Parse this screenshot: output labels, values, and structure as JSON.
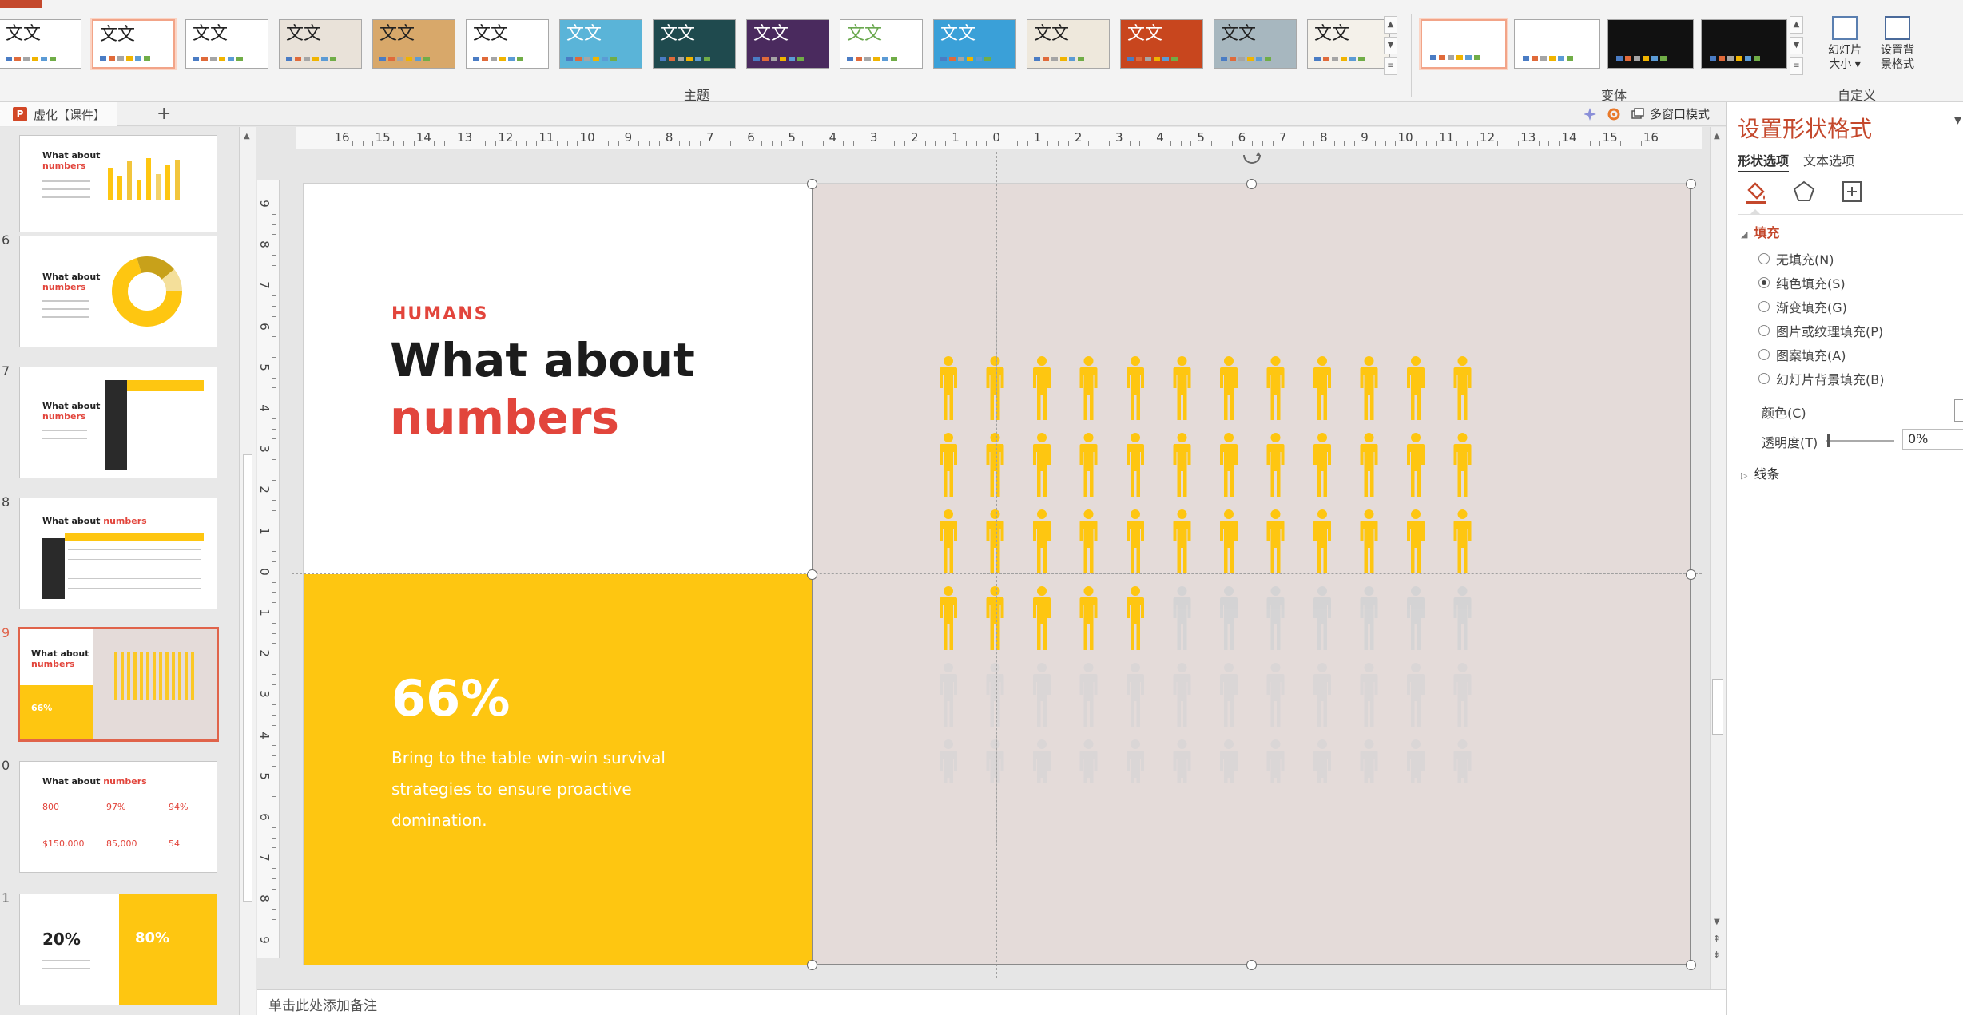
{
  "ribbon": {
    "theme_group_label": "主题",
    "variant_group_label": "变体",
    "custom_group_label": "自定义",
    "theme_sample_text": "文文",
    "slide_size_label_1": "幻灯片",
    "slide_size_label_2": "大小 ▾",
    "bg_format_label_1": "设置背",
    "bg_format_label_2": "景格式",
    "themes": [
      {
        "bg": "#ffffff",
        "fg": "#222222"
      },
      {
        "bg": "#ffffff",
        "fg": "#222222",
        "selected": true
      },
      {
        "bg": "#ffffff",
        "fg": "#222222"
      },
      {
        "bg": "#e9e2d9",
        "fg": "#222222"
      },
      {
        "bg": "#d8a86a",
        "fg": "#222222"
      },
      {
        "bg": "#ffffff",
        "fg": "#222222"
      },
      {
        "bg": "#5ab4d8",
        "fg": "#ffffff"
      },
      {
        "bg": "#1f4a4e",
        "fg": "#ffffff"
      },
      {
        "bg": "#4a2a5e",
        "fg": "#ffffff"
      },
      {
        "bg": "#ffffff",
        "fg": "#6aa84f"
      },
      {
        "bg": "#3aa0d8",
        "fg": "#ffffff"
      },
      {
        "bg": "#eee8dc",
        "fg": "#222222"
      },
      {
        "bg": "#c8461e",
        "fg": "#ffffff"
      },
      {
        "bg": "#a7b7bf",
        "fg": "#222222"
      },
      {
        "bg": "#f4f1ea",
        "fg": "#222222"
      }
    ],
    "variants": [
      {
        "bg": "#ffffff",
        "selected": true
      },
      {
        "bg": "#ffffff"
      },
      {
        "bg": "#111111"
      },
      {
        "bg": "#111111"
      }
    ]
  },
  "tabbar": {
    "doc_tab": "虚化【课件】",
    "add": "+",
    "multi_window": "多窗口模式"
  },
  "thumbnails": {
    "numbers": [
      "6",
      "7",
      "8",
      "9",
      "0",
      "1"
    ],
    "titles": [
      "What about",
      "What about",
      "What about",
      "What about ",
      "What about",
      "What about ",
      "What about"
    ],
    "red_word": "numbers",
    "thumb_stats": {
      "a": "66%",
      "b": "20%",
      "c": "80%"
    },
    "thumb_values": [
      "800",
      "97%",
      "94%",
      "$150,000",
      "85,000",
      "54"
    ]
  },
  "ruler": {
    "h_ticks": [
      "16",
      "15",
      "14",
      "13",
      "12",
      "11",
      "10",
      "9",
      "8",
      "7",
      "6",
      "5",
      "4",
      "3",
      "2",
      "1",
      "0",
      "1",
      "2",
      "3",
      "4",
      "5",
      "6",
      "7",
      "8",
      "9",
      "10",
      "11",
      "12",
      "13",
      "14",
      "15",
      "16"
    ],
    "v_ticks": [
      "9",
      "8",
      "7",
      "6",
      "5",
      "4",
      "3",
      "2",
      "1",
      "0",
      "1",
      "2",
      "3",
      "4",
      "5",
      "6",
      "7",
      "8",
      "9"
    ]
  },
  "slide": {
    "kicker": "HUMANS",
    "title_line1": "What about",
    "title_line2": "numbers",
    "stat": "66%",
    "description": "Bring to the table win-win survival strategies to ensure proactive domination.",
    "people_total": 72,
    "people_filled": 41,
    "people_columns": 12,
    "colors": {
      "yellow": "#fec611",
      "red": "#e2453c",
      "panel": "#e4dbd9",
      "person_empty": "#d2d2d4"
    }
  },
  "notes": {
    "placeholder": "单击此处添加备注"
  },
  "format_pane": {
    "title": "设置形状格式",
    "close": "▾",
    "tab_shape": "形状选项",
    "tab_text": "文本选项",
    "fill_header": "填充",
    "fill_options": [
      {
        "label": "无填充(N)",
        "checked": false
      },
      {
        "label": "纯色填充(S)",
        "checked": true
      },
      {
        "label": "渐变填充(G)",
        "checked": false
      },
      {
        "label": "图片或纹理填充(P)",
        "checked": false
      },
      {
        "label": "图案填充(A)",
        "checked": false
      },
      {
        "label": "幻灯片背景填充(B)",
        "checked": false
      }
    ],
    "color_label": "颜色(C)",
    "transparency_label": "透明度(T)",
    "transparency_value": "0%",
    "line_header": "线条"
  }
}
